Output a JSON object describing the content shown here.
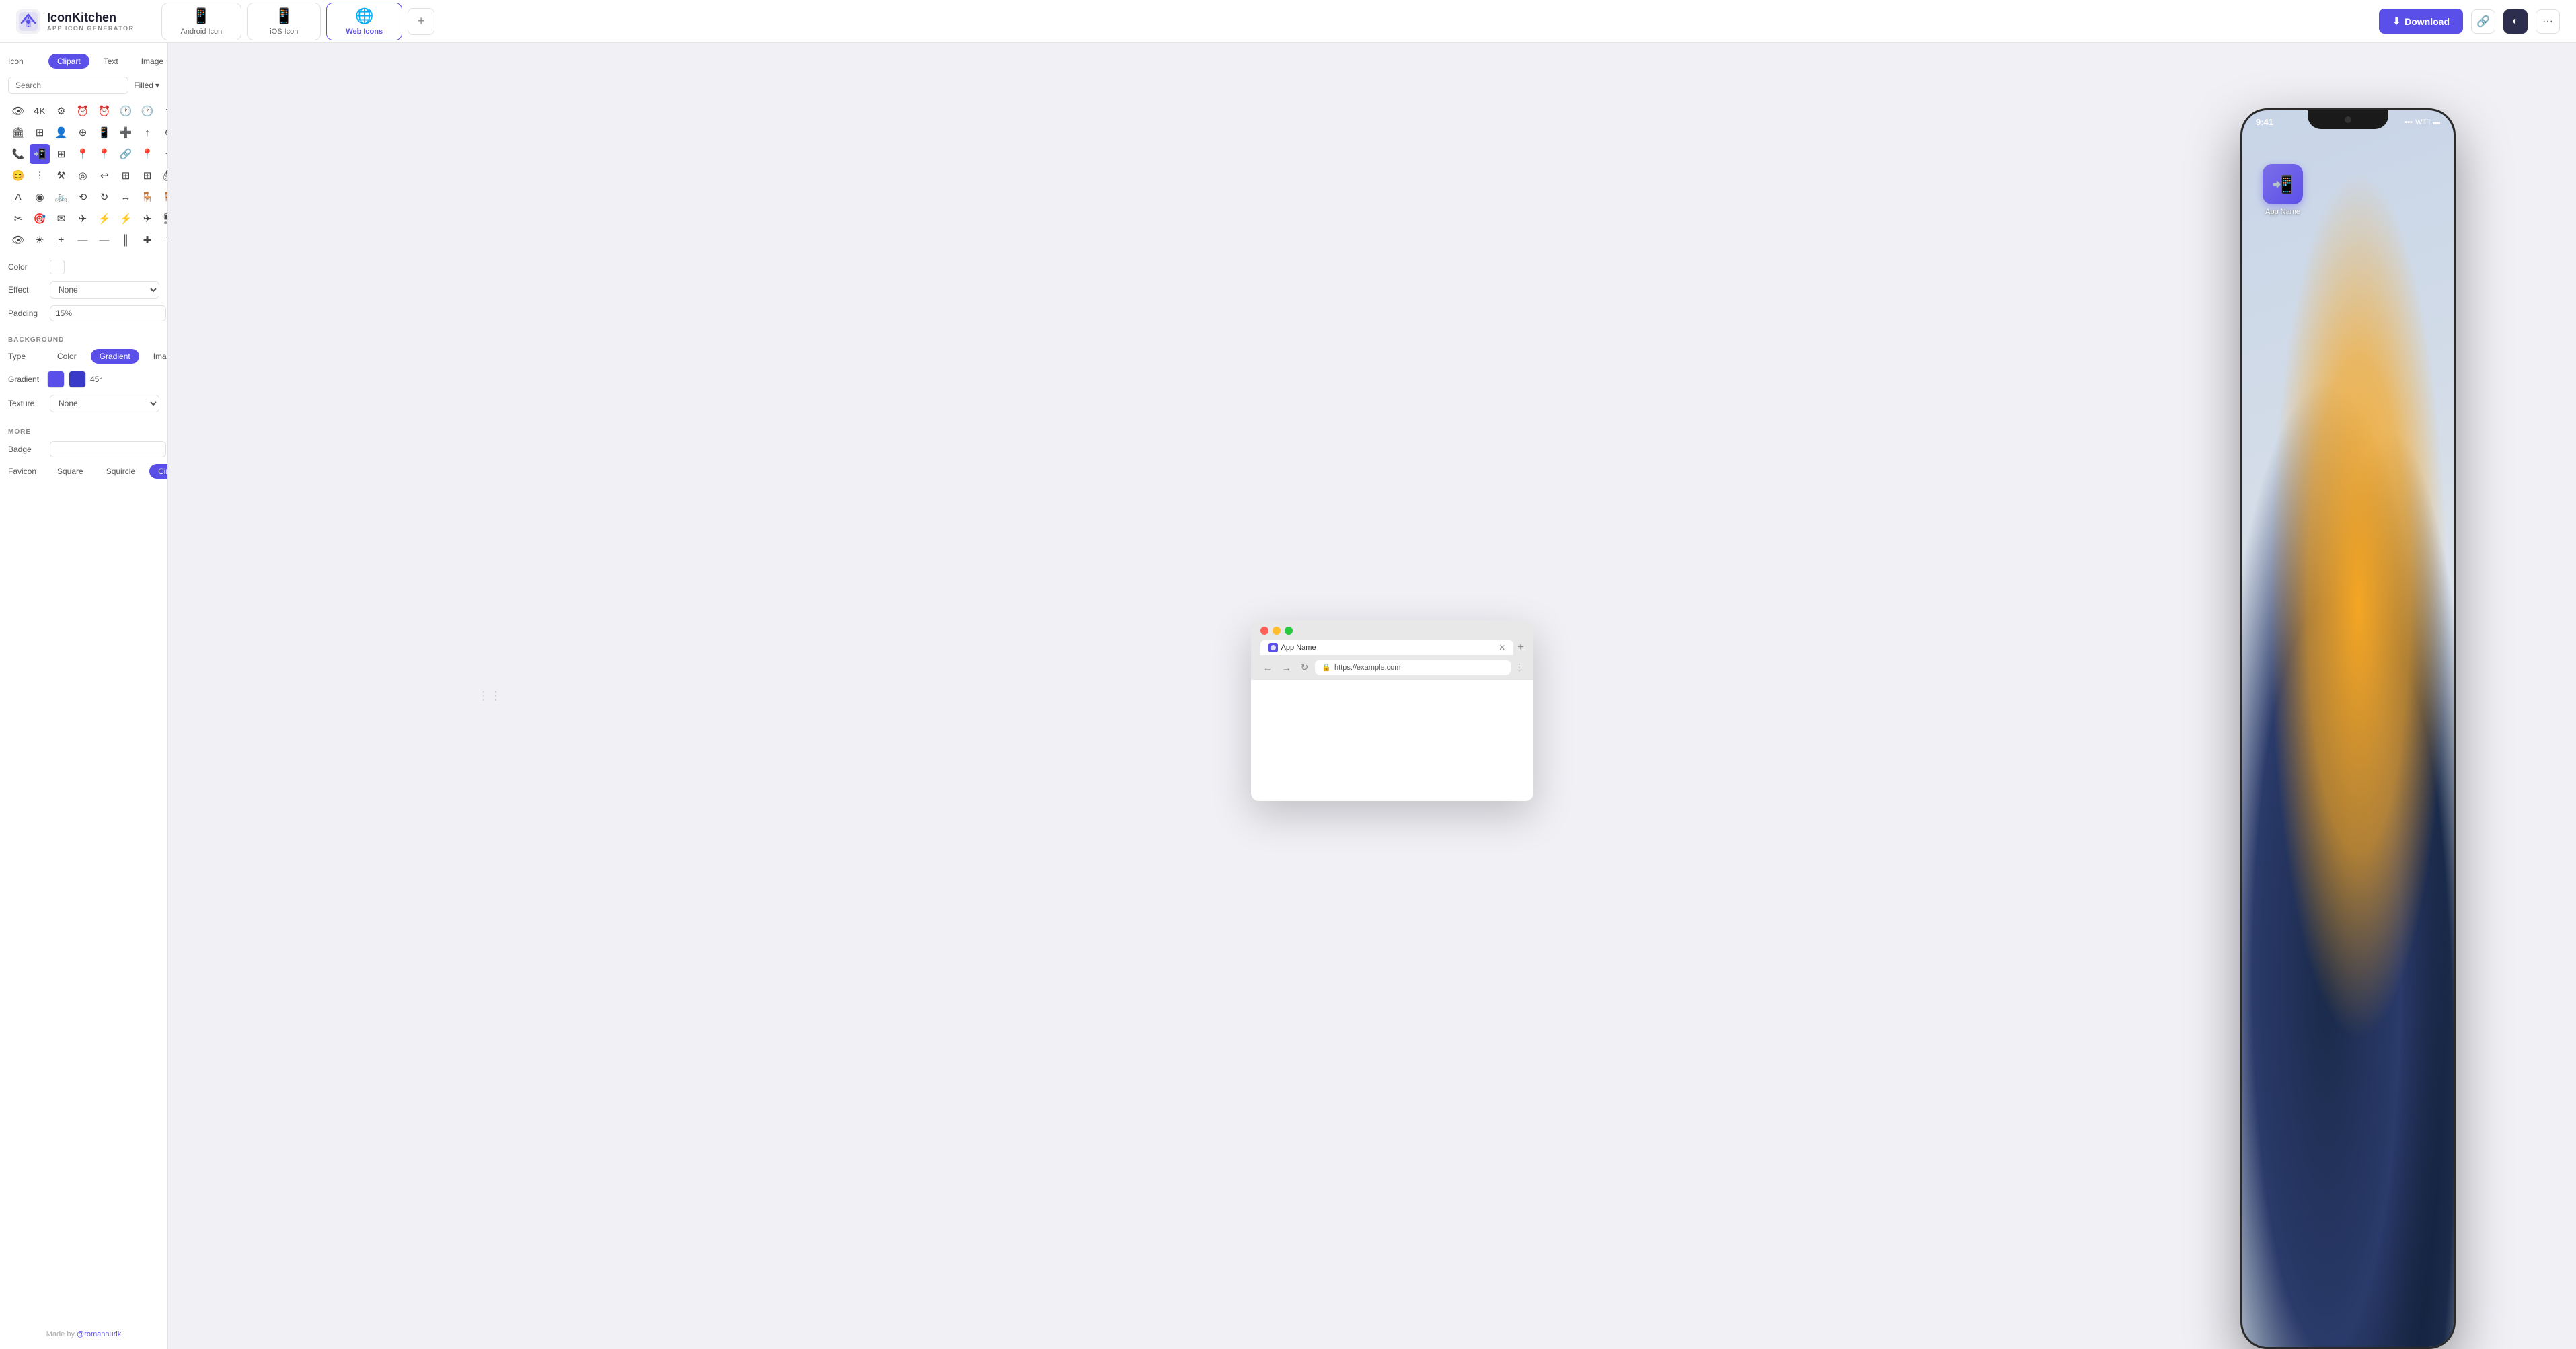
{
  "app": {
    "title": "IconKitchen",
    "subtitle": "APP ICON GENERATOR"
  },
  "header": {
    "tabs": [
      {
        "id": "android",
        "label": "Android Icon",
        "active": false
      },
      {
        "id": "ios",
        "label": "iOS Icon",
        "active": false
      },
      {
        "id": "web",
        "label": "Web Icons",
        "active": true
      }
    ],
    "add_tab_label": "+",
    "download_label": "Download",
    "link_icon": "🔗",
    "theme_icon": "◐",
    "more_icon": "···"
  },
  "sidebar": {
    "icon_section_label": "Icon",
    "tabs": [
      {
        "id": "clipart",
        "label": "Clipart",
        "active": true
      },
      {
        "id": "text",
        "label": "Text",
        "active": false
      },
      {
        "id": "image",
        "label": "Image",
        "active": false
      }
    ],
    "search_placeholder": "Search",
    "filter_label": "Filled",
    "color_label": "Color",
    "effect_label": "Effect",
    "effect_value": "None",
    "padding_label": "Padding",
    "padding_value": "15%",
    "background_section": "BACKGROUND",
    "bg_type_label": "Type",
    "bg_types": [
      {
        "id": "color",
        "label": "Color",
        "active": false
      },
      {
        "id": "gradient",
        "label": "Gradient",
        "active": true
      },
      {
        "id": "image",
        "label": "Image",
        "active": false
      }
    ],
    "gradient_label": "Gradient",
    "gradient_color1": "#5b4fe9",
    "gradient_color2": "#3a3ac8",
    "gradient_angle": "45°",
    "texture_label": "Texture",
    "texture_value": "None",
    "more_section": "MORE",
    "badge_label": "Badge",
    "badge_placeholder": "",
    "favicon_label": "Favicon",
    "favicon_options": [
      {
        "id": "square",
        "label": "Square",
        "active": false
      },
      {
        "id": "squircle",
        "label": "Squircle",
        "active": false
      },
      {
        "id": "circle",
        "label": "Circle",
        "active": true
      }
    ],
    "footer_text": "Made by ",
    "footer_link": "@romannurik"
  },
  "browser_mockup": {
    "tab_name": "App Name",
    "url": "https://example.com",
    "new_tab": "+"
  },
  "phone_mockup": {
    "time": "9:41",
    "app_name": "App Name"
  }
}
